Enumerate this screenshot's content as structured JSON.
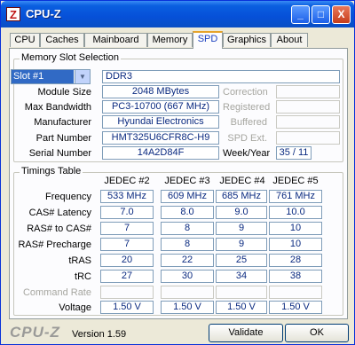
{
  "window": {
    "title": "CPU-Z",
    "app_icon_glyph": "Z",
    "minimize_glyph": "_",
    "maximize_glyph": "□",
    "close_glyph": "X"
  },
  "tabs": [
    {
      "label": "CPU"
    },
    {
      "label": "Caches"
    },
    {
      "label": "Mainboard"
    },
    {
      "label": "Memory"
    },
    {
      "label": "SPD",
      "active": true
    },
    {
      "label": "Graphics"
    },
    {
      "label": "About"
    }
  ],
  "memory_slot": {
    "group_title": "Memory Slot Selection",
    "slot_selected": "Slot #1",
    "type": "DDR3",
    "module_size_label": "Module Size",
    "module_size": "2048 MBytes",
    "max_bandwidth_label": "Max Bandwidth",
    "max_bandwidth": "PC3-10700 (667 MHz)",
    "manufacturer_label": "Manufacturer",
    "manufacturer": "Hyundai Electronics",
    "part_number_label": "Part Number",
    "part_number": "HMT325U6CFR8C-H9",
    "serial_number_label": "Serial Number",
    "serial_number": "14A2D84F",
    "correction_label": "Correction",
    "registered_label": "Registered",
    "buffered_label": "Buffered",
    "spd_ext_label": "SPD Ext.",
    "week_year_label": "Week/Year",
    "week_year": "35 / 11"
  },
  "timings": {
    "group_title": "Timings Table",
    "columns": [
      "JEDEC #2",
      "JEDEC #3",
      "JEDEC #4",
      "JEDEC #5"
    ],
    "rows": [
      {
        "label": "Frequency",
        "values": [
          "533 MHz",
          "609 MHz",
          "685 MHz",
          "761 MHz"
        ]
      },
      {
        "label": "CAS# Latency",
        "values": [
          "7.0",
          "8.0",
          "9.0",
          "10.0"
        ]
      },
      {
        "label": "RAS# to CAS#",
        "values": [
          "7",
          "8",
          "9",
          "10"
        ]
      },
      {
        "label": "RAS# Precharge",
        "values": [
          "7",
          "8",
          "9",
          "10"
        ]
      },
      {
        "label": "tRAS",
        "values": [
          "20",
          "22",
          "25",
          "28"
        ]
      },
      {
        "label": "tRC",
        "values": [
          "27",
          "30",
          "34",
          "38"
        ]
      },
      {
        "label": "Command Rate",
        "values": [
          "",
          "",
          "",
          ""
        ],
        "disabled": true
      },
      {
        "label": "Voltage",
        "values": [
          "1.50 V",
          "1.50 V",
          "1.50 V",
          "1.50 V"
        ]
      }
    ]
  },
  "footer": {
    "logo": "CPU-Z",
    "version": "Version 1.59",
    "validate_label": "Validate",
    "ok_label": "OK"
  }
}
